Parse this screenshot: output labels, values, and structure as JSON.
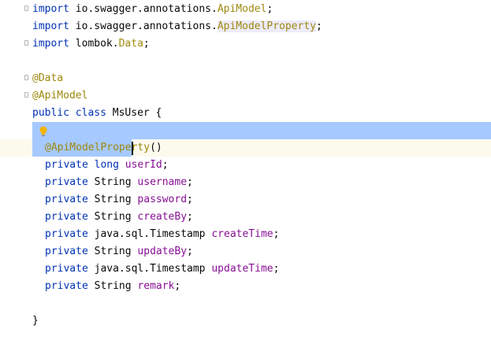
{
  "editor": {
    "lines": {
      "imp1": {
        "kw": "import",
        "path": " io.swagger.annotations.",
        "cls": "ApiModel",
        "end": ";"
      },
      "imp2": {
        "kw": "import",
        "path": " io.swagger.annotations.",
        "cls": "ApiModelProperty",
        "end": ";"
      },
      "imp3": {
        "kw": "import",
        "path": " lombok.",
        "cls": "Data",
        "end": ";"
      },
      "ann_data": "@Data",
      "ann_apimodel": "@ApiModel",
      "class_decl": {
        "kw1": "public",
        "kw2": " class",
        "name": " MsUser {"
      },
      "field_ann": {
        "ann_selected": "@ApiModelPrope",
        "ann_rest": "rty",
        "parens": "()"
      },
      "fields": [
        {
          "mod": "private",
          "type": " long ",
          "name": "userId",
          "end": ";"
        },
        {
          "mod": "private",
          "type": " String ",
          "name": "username",
          "end": ";"
        },
        {
          "mod": "private",
          "type": " String ",
          "name": "password",
          "end": ";"
        },
        {
          "mod": "private",
          "type": " String ",
          "name": "createBy",
          "end": ";"
        },
        {
          "mod": "private",
          "type": " java.sql.Timestamp ",
          "name": "createTime",
          "end": ";"
        },
        {
          "mod": "private",
          "type": " String ",
          "name": "updateBy",
          "end": ";"
        },
        {
          "mod": "private",
          "type": " java.sql.Timestamp ",
          "name": "updateTime",
          "end": ";"
        },
        {
          "mod": "private",
          "type": " String ",
          "name": "remark",
          "end": ";"
        }
      ],
      "close": "}"
    },
    "colors": {
      "keyword": "#0033b3",
      "annotation": "#9e880d",
      "field": "#871094",
      "text": "#080808",
      "selection": "#a6c9ff",
      "current_line": "#fcfaed"
    },
    "icons": {
      "intention": "lightbulb-icon"
    }
  }
}
